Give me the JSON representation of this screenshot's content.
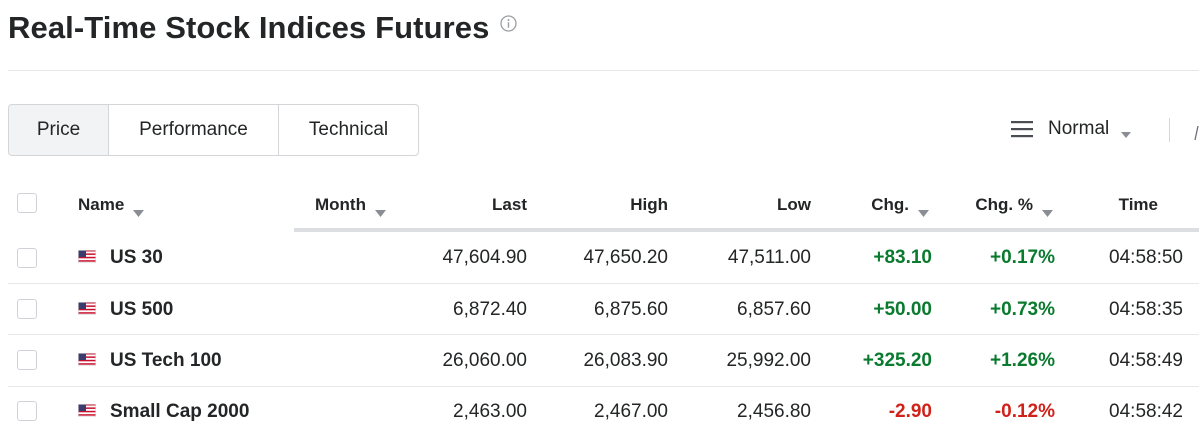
{
  "header": {
    "title": "Real-Time Stock Indices Futures",
    "info_icon": "info-icon"
  },
  "tabs": [
    {
      "label": "Price",
      "active": true
    },
    {
      "label": "Performance",
      "active": false
    },
    {
      "label": "Technical",
      "active": false
    }
  ],
  "view": {
    "label": "Normal",
    "icon": "menu-icon"
  },
  "columns": {
    "name": "Name",
    "month": "Month",
    "last": "Last",
    "high": "High",
    "low": "Low",
    "chg": "Chg.",
    "chg_pct": "Chg. %",
    "time": "Time"
  },
  "rows": [
    {
      "name": "US 30",
      "flag": "us-flag",
      "last": "47,604.90",
      "high": "47,650.20",
      "low": "47,511.00",
      "chg": "+83.10",
      "chg_pct": "+0.17%",
      "time": "04:58:50",
      "direction": "up"
    },
    {
      "name": "US 500",
      "flag": "us-flag",
      "last": "6,872.40",
      "high": "6,875.60",
      "low": "6,857.60",
      "chg": "+50.00",
      "chg_pct": "+0.73%",
      "time": "04:58:35",
      "direction": "up"
    },
    {
      "name": "US Tech 100",
      "flag": "us-flag",
      "last": "26,060.00",
      "high": "26,083.90",
      "low": "25,992.00",
      "chg": "+325.20",
      "chg_pct": "+1.26%",
      "time": "04:58:49",
      "direction": "up"
    },
    {
      "name": "Small Cap 2000",
      "flag": "us-flag",
      "last": "2,463.00",
      "high": "2,467.00",
      "low": "2,456.80",
      "chg": "-2.90",
      "chg_pct": "-0.12%",
      "time": "04:58:42",
      "direction": "down"
    }
  ],
  "colors": {
    "positive": "#0a7a2f",
    "negative": "#d0221a"
  }
}
